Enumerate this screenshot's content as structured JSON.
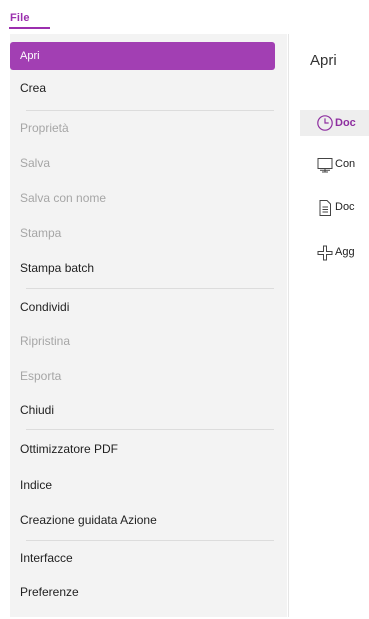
{
  "menubar": {
    "file_label": "File"
  },
  "sidebar": {
    "items": [
      {
        "label": "Apri",
        "state": "selected"
      },
      {
        "label": "Crea",
        "state": "enabled"
      },
      {
        "label": "Proprietà",
        "state": "disabled"
      },
      {
        "label": "Salva",
        "state": "disabled"
      },
      {
        "label": "Salva con nome",
        "state": "disabled"
      },
      {
        "label": "Stampa",
        "state": "disabled"
      },
      {
        "label": "Stampa batch",
        "state": "enabled"
      },
      {
        "label": "Condividi",
        "state": "enabled"
      },
      {
        "label": "Ripristina",
        "state": "disabled"
      },
      {
        "label": "Esporta",
        "state": "disabled"
      },
      {
        "label": "Chiudi",
        "state": "enabled"
      },
      {
        "label": "Ottimizzatore PDF",
        "state": "enabled"
      },
      {
        "label": "Indice",
        "state": "enabled"
      },
      {
        "label": "Creazione guidata Azione",
        "state": "enabled"
      },
      {
        "label": "Interfacce",
        "state": "enabled"
      },
      {
        "label": "Preferenze",
        "state": "enabled"
      }
    ]
  },
  "panel": {
    "title": "Apri",
    "options": [
      {
        "label": "Doc",
        "icon": "clock-icon",
        "active": true
      },
      {
        "label": "Con",
        "icon": "computer-icon",
        "active": false
      },
      {
        "label": "Doc",
        "icon": "document-icon",
        "active": false
      },
      {
        "label": "Agg",
        "icon": "add-location-icon",
        "active": false
      }
    ]
  },
  "colors": {
    "accent": "#a23fb3",
    "file_tab": "#9b2fae",
    "sidebar_bg": "#f3f3f3",
    "disabled_text": "#a6a6a6"
  }
}
